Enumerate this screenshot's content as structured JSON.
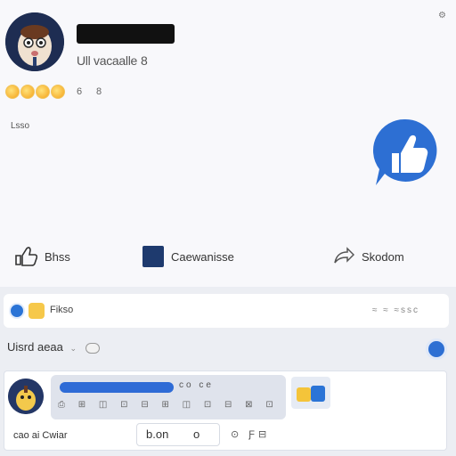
{
  "profile": {
    "subline": "Ull vacaalle",
    "subline_num": "8",
    "reaction_count": "6",
    "reaction_count2": "8",
    "caption": "Lsso"
  },
  "actions": {
    "like_label": "Bhss",
    "comment_label": "Caewanisse",
    "share_label": "Skodom"
  },
  "row1": {
    "label": "Fikso",
    "meta": "≈ ≈ ≈ssc"
  },
  "row2": {
    "label": "Uisrd",
    "label2": "aeaa",
    "small": "⌄"
  },
  "composer": {
    "bar_meta": "co ce",
    "icons": "⎙ ⊞ ◫ ⊡ ⊟ ⊞ ◫ ⊡ ⊟ ⊠ ⊡"
  },
  "card": {
    "row_label": "cao ai",
    "row_label2": "Cwiar",
    "button_label": "b.on",
    "button_dot": "o",
    "icons": "⊙ Ƒ⊟"
  },
  "colors": {
    "brand_blue": "#2d6fd3",
    "dark_navy": "#1e3a6e",
    "reaction_yellow": "#f4a11a"
  }
}
